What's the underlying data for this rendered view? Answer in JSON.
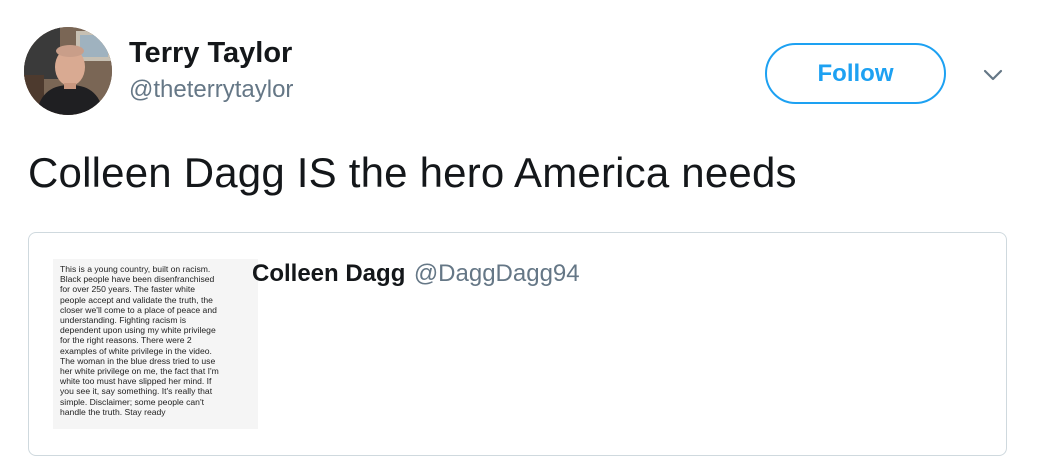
{
  "tweet": {
    "author": {
      "display_name": "Terry Taylor",
      "handle": "@theterrytaylor"
    },
    "follow_label": "Follow",
    "text": "Colleen Dagg IS the hero America needs",
    "quoted": {
      "display_name": "Colleen Dagg",
      "handle": "@DaggDagg94",
      "image_text": "This is a young country, built on racism.\nBlack people have been disenfranchised\nfor over 250 years. The faster white\npeople accept and validate the truth, the\ncloser we'll come to a place of peace and\nunderstanding.  Fighting racism is\ndependent upon using my white privilege\nfor the right reasons. There were 2\nexamples of white privilege in the video.\nThe woman in the blue dress tried to use\nher white privilege on me, the fact that I'm\nwhite too must have slipped her mind. If\nyou see it, say something. It's really that\nsimple. Disclaimer; some people can't\nhandle the truth. Stay ready"
    }
  },
  "icons": {
    "avatar": "profile-photo",
    "caret": "chevron-down-icon"
  },
  "colors": {
    "accent": "#1da1f2",
    "text_primary": "#14171a",
    "text_secondary": "#657786",
    "border": "#cfd9de"
  }
}
